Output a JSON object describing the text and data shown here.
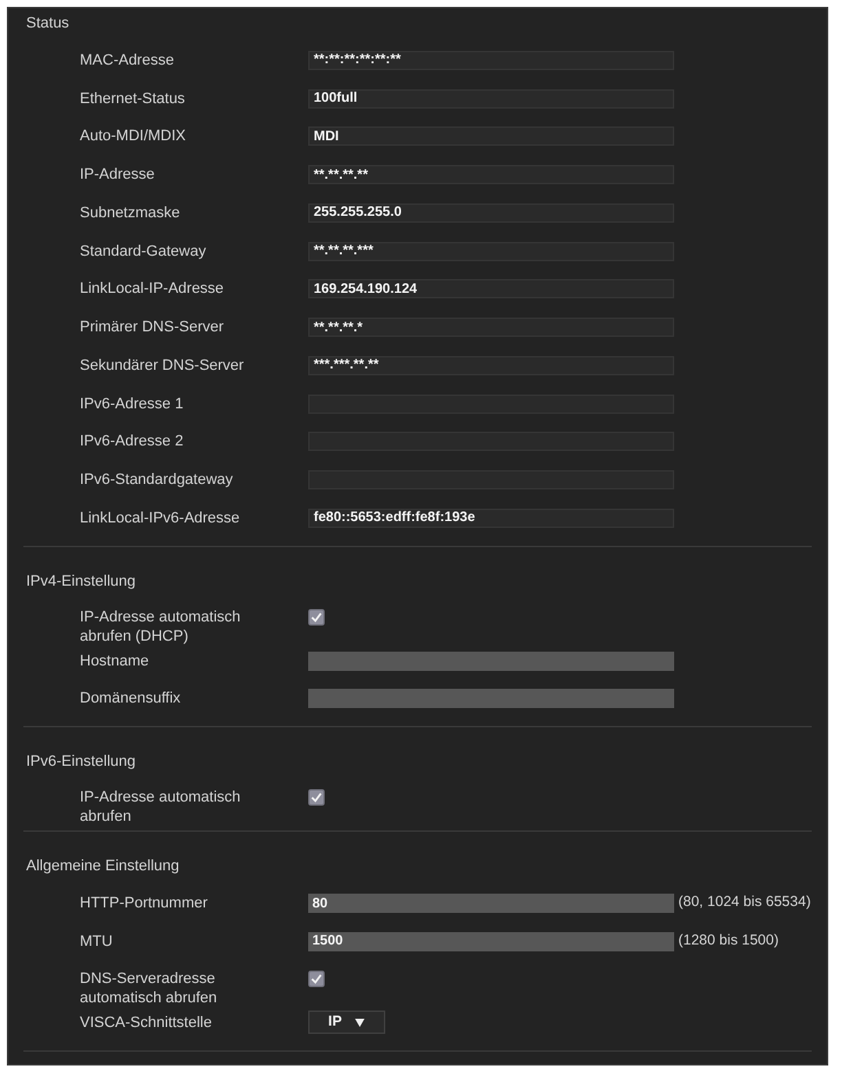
{
  "sections": [
    {
      "title": "Status",
      "rows": [
        {
          "kind": "readonly",
          "label": "MAC-Adresse",
          "value": "**:**:**:**:**:**"
        },
        {
          "kind": "readonly",
          "label": "Ethernet-Status",
          "value": "100full"
        },
        {
          "kind": "readonly",
          "label": "Auto-MDI/MDIX",
          "value": "MDI"
        },
        {
          "kind": "readonly",
          "label": "IP-Adresse",
          "value": "**.**.**.**"
        },
        {
          "kind": "readonly",
          "label": "Subnetzmaske",
          "value": "255.255.255.0"
        },
        {
          "kind": "readonly",
          "label": "Standard-Gateway",
          "value": "**.**.**.***"
        },
        {
          "kind": "readonly",
          "label": "LinkLocal-IP-Adresse",
          "value": "169.254.190.124"
        },
        {
          "kind": "readonly",
          "label": "Primärer DNS-Server",
          "value": "**.**.**.*"
        },
        {
          "kind": "readonly",
          "label": "Sekundärer DNS-Server",
          "value": "***.***.**.**"
        },
        {
          "kind": "readonly",
          "label": "IPv6-Adresse 1"
        },
        {
          "kind": "readonly",
          "label": "IPv6-Adresse 2"
        },
        {
          "kind": "readonly",
          "label": "IPv6-Standardgateway"
        },
        {
          "kind": "readonly",
          "label": "LinkLocal-IPv6-Adresse",
          "value": "fe80::5653:edff:fe8f:193e"
        }
      ]
    },
    {
      "title": "IPv4-Einstellung",
      "rows": [
        {
          "kind": "checkbox",
          "label": "IP-Adresse automatisch abrufen (DHCP)",
          "checked": true
        },
        {
          "kind": "text",
          "label": "Hostname"
        },
        {
          "kind": "text",
          "label": "Domänensuffix"
        }
      ]
    },
    {
      "title": "IPv6-Einstellung",
      "rows": [
        {
          "kind": "checkbox",
          "label": "IP-Adresse automatisch abrufen",
          "checked": true
        }
      ]
    },
    {
      "title": "Allgemeine Einstellung",
      "rows": [
        {
          "kind": "text",
          "label": "HTTP-Portnummer",
          "value": "80",
          "hint": "(80, 1024 bis 65534)"
        },
        {
          "kind": "text",
          "label": "MTU",
          "value": "1500",
          "hint": "(1280 bis 1500)"
        },
        {
          "kind": "checkbox",
          "label": "DNS-Serveradresse automatisch abrufen",
          "checked": true
        },
        {
          "kind": "select",
          "label": "VISCA-Schnittstelle",
          "value": "IP"
        }
      ]
    }
  ]
}
